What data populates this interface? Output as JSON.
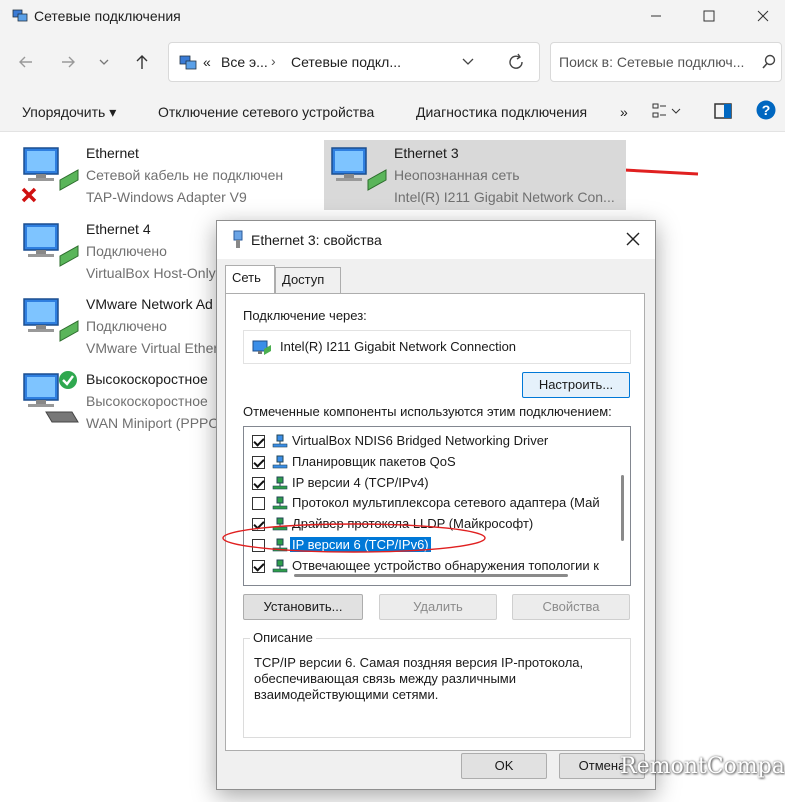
{
  "window": {
    "title": "Сетевые подключения"
  },
  "address": {
    "segments": [
      "«",
      "Все э...",
      "Сетевые подкл..."
    ]
  },
  "search": {
    "placeholder": "Поиск в: Сетевые подключ..."
  },
  "toolbar": {
    "organize": "Упорядочить",
    "disable": "Отключение сетевого устройства",
    "diagnose": "Диагностика подключения",
    "more": "»"
  },
  "adapters": [
    {
      "name": "Ethernet",
      "status": "Сетевой кабель не подключен",
      "device": "TAP-Windows Adapter V9",
      "state_icon": "red-x-icon"
    },
    {
      "name": "Ethernet 3",
      "status": "Неопознанная сеть",
      "device": "Intel(R) I211 Gigabit Network Con...",
      "state_icon": "none"
    },
    {
      "name": "Ethernet 4",
      "status": "Подключено",
      "device": "VirtualBox Host-Only",
      "state_icon": "none"
    },
    {
      "name": "VMware Network Ad",
      "status": "Подключено",
      "device": "VMware Virtual Ether",
      "state_icon": "none"
    },
    {
      "name": "Высокоскоростное",
      "status": "Высокоскоростное",
      "device": "WAN Miniport (PPPO",
      "state_icon": "green-check-icon"
    }
  ],
  "dialog": {
    "title": "Ethernet 3: свойства",
    "tabs": [
      "Сеть",
      "Доступ"
    ],
    "connect_using_label": "Подключение через:",
    "device_name": "Intel(R) I211 Gigabit Network Connection",
    "configure_button": "Настроить...",
    "components_label": "Отмеченные компоненты используются этим подключением:",
    "components": [
      {
        "checked": true,
        "label": "VirtualBox NDIS6 Bridged Networking Driver",
        "selected": false
      },
      {
        "checked": true,
        "label": "Планировщик пакетов QoS",
        "selected": false
      },
      {
        "checked": true,
        "label": "IP версии 4 (TCP/IPv4)",
        "selected": false
      },
      {
        "checked": false,
        "label": "Протокол мультиплексора сетевого адаптера (Май",
        "selected": false
      },
      {
        "checked": true,
        "label": "Драйвер протокола LLDP (Майкрософт)",
        "selected": false
      },
      {
        "checked": false,
        "label": "IP версии 6 (TCP/IPv6)",
        "selected": true
      },
      {
        "checked": true,
        "label": "Отвечающее устройство обнаружения топологии к",
        "selected": false
      }
    ],
    "install_button": "Установить...",
    "remove_button": "Удалить",
    "properties_button": "Свойства",
    "description_label": "Описание",
    "description_text": "TCP/IP версии 6. Самая поздняя версия IP-протокола, обеспечивающая связь между различными взаимодействующими сетями.",
    "ok_button": "OK",
    "cancel_button": "Отмена"
  },
  "watermark": "RemontCompa.ru",
  "colors": {
    "selection": "#0078d7",
    "annotation": "#e02020",
    "accent": "#0067c0"
  }
}
